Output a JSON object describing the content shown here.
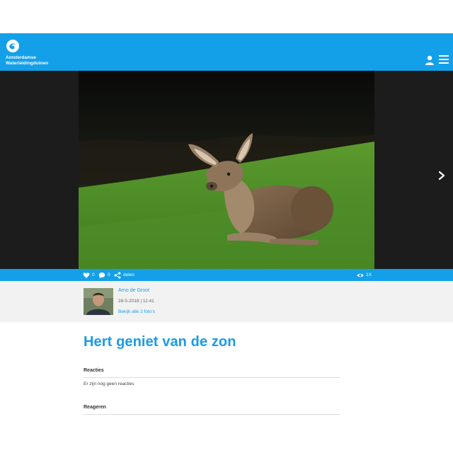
{
  "header": {
    "brand_line1": "Amsterdamse",
    "brand_line2": "Waterleidingduinen",
    "colors": {
      "brand": "#13a0e8"
    },
    "icons": [
      "logo-icon",
      "user-icon",
      "menu-icon"
    ]
  },
  "photo": {
    "icons": [
      "next-arrow-icon"
    ]
  },
  "actions": {
    "likes": "0",
    "comments": "0",
    "share_label": "delen",
    "views": "1X"
  },
  "author": {
    "name": "Arno de Groot",
    "date": "28-5-2018 | 11:41",
    "all_photos_link": "Bekijk alle 2 foto's"
  },
  "post": {
    "title": "Hert geniet van de zon"
  },
  "reactions": {
    "heading": "Reacties",
    "empty_text": "Er zijn nog geen reacties"
  },
  "respond": {
    "heading": "Reageren"
  }
}
